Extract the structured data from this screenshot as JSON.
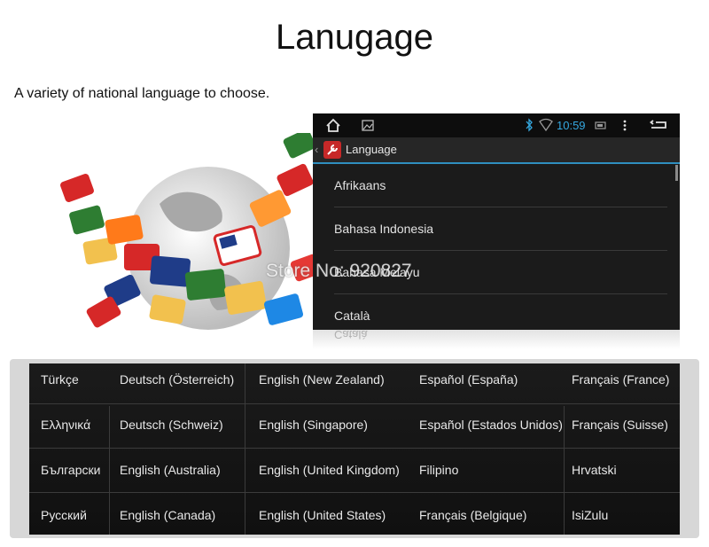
{
  "header": {
    "title": "Lanugage",
    "subtitle": "A variety of national language to choose."
  },
  "watermark": "Store No: 920827",
  "android": {
    "status": {
      "time": "10:59",
      "icons": [
        "home-icon",
        "gallery-icon",
        "bluetooth-icon",
        "wifi-icon",
        "battery-icon",
        "overflow-menu-icon",
        "back-icon"
      ]
    },
    "action_bar": {
      "title": "Language",
      "icon": "settings-wrench-icon"
    },
    "languages": [
      "Afrikaans",
      "Bahasa Indonesia",
      "Bahasa Melayu",
      "Català"
    ],
    "reflection_text": "Català"
  },
  "table": {
    "rows": [
      [
        "Türkçe",
        "Deutsch (Österreich)",
        "English (New Zealand)",
        "Español (España)",
        "Français (France)"
      ],
      [
        "Ελληνικά",
        "Deutsch (Schweiz)",
        "English (Singapore)",
        "Español (Estados Unidos)",
        "Français (Suisse)"
      ],
      [
        "Български",
        "English (Australia)",
        "English (United Kingdom)",
        "Filipino",
        "Hrvatski"
      ],
      [
        "Русский",
        "English (Canada)",
        "English (United States)",
        "Français (Belgique)",
        "IsiZulu"
      ]
    ]
  },
  "colors": {
    "accent": "#2f8fbf",
    "table_bg": "#141414",
    "status_bar": "#0d0d0d"
  }
}
